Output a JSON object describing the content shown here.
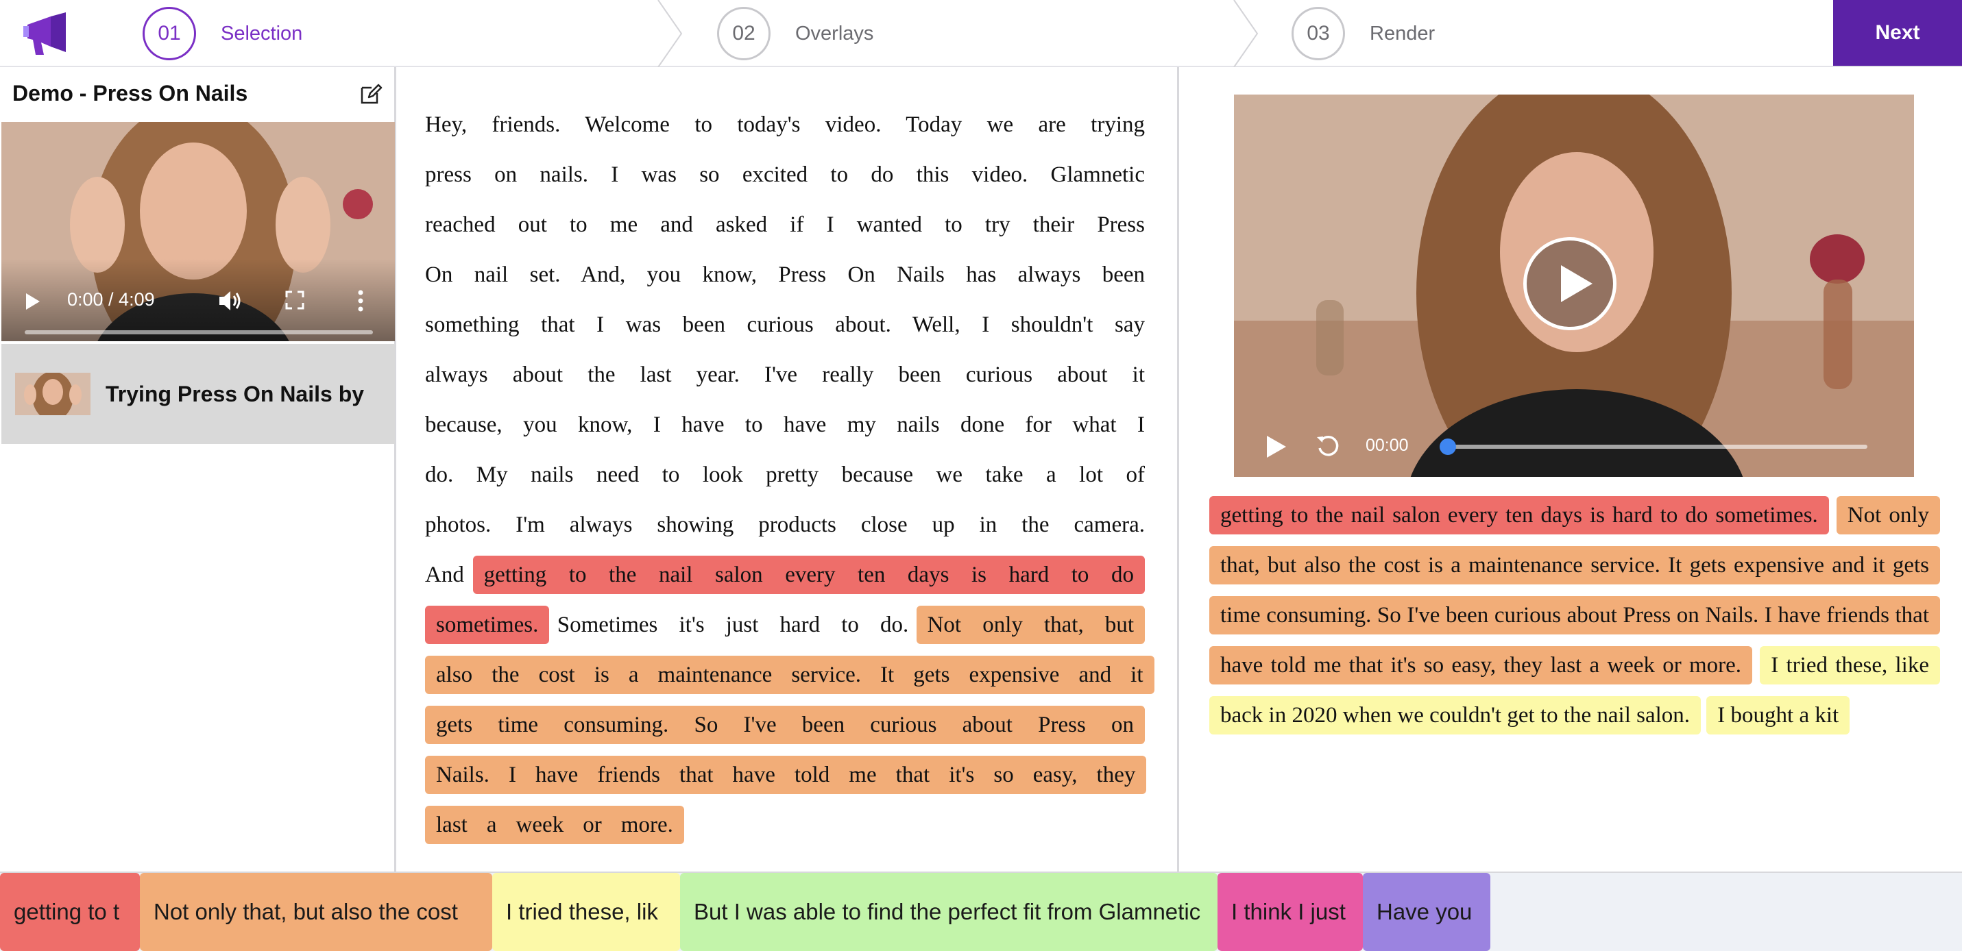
{
  "header": {
    "steps": [
      {
        "number": "01",
        "label": "Selection"
      },
      {
        "number": "02",
        "label": "Overlays"
      },
      {
        "number": "03",
        "label": "Render"
      }
    ],
    "next_label": "Next"
  },
  "sidebar": {
    "project_title": "Demo - Press On Nails",
    "video_time": "0:00 / 4:09",
    "items": [
      {
        "label": "Trying Press On Nails by"
      }
    ]
  },
  "transcript": {
    "before": "Hey, friends. Welcome to today's video. Today we are trying press on nails. I was so excited to do this video. Glamnetic reached out to me and asked if I wanted to try their Press On nail set. And, you know, Press On Nails has always been something that I was been curious about. Well, I shouldn't say always about the last year. I've really been curious about it because, you know, I have to have my nails done for what I do. My nails need to look pretty because we take a lot of photos. I'm always showing products close up in the camera. And",
    "highlight_red": "getting to the nail salon every ten days is hard to do sometimes.",
    "middle": "Sometimes it's just hard to do.",
    "highlight_orange": "Not only that, but also the cost is a maintenance service. It gets expensive and it gets time consuming. So I've been curious about Press on Nails. I have friends that have told me that it's so easy, they last a week or more."
  },
  "preview": {
    "time": "00:00",
    "highlight_red": "getting to the nail salon every ten days is hard to do sometimes.",
    "highlight_orange": "Not only that, but also the cost is a maintenance service. It gets expensive and it gets time consuming. So I've been curious about Press on Nails. I have friends that have told me that it's so easy, they last a week or more.",
    "highlight_yellow": "I tried these, like back in 2020 when we couldn't get to the nail salon.",
    "tail": "I bought a kit"
  },
  "clips": [
    {
      "label": "getting to t",
      "color": "#ee6e6a"
    },
    {
      "label": "Not only that, but also the cost",
      "color": "#f2ad78"
    },
    {
      "label": "I tried these, lik",
      "color": "#fcf9a8"
    },
    {
      "label": "But I was able to find the perfect fit from Glamnetic",
      "color": "#c3f4aa"
    },
    {
      "label": "I think I just",
      "color": "#e85aa4"
    },
    {
      "label": "Have you",
      "color": "#9b83e0"
    }
  ],
  "colors": {
    "accent": "#7a2fc5",
    "next_button": "#5b22a6",
    "highlight_red": "#ee6e6a",
    "highlight_orange": "#f2ad78",
    "highlight_yellow": "#fcf9a8"
  }
}
